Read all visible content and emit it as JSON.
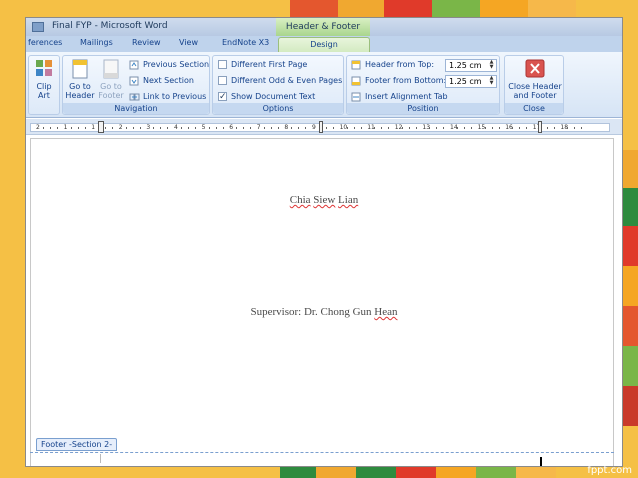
{
  "app": {
    "window_title": "Final FYP - Microsoft Word",
    "contextual_tools": "Header & Footer Tools"
  },
  "tabs": [
    {
      "label": "ferences"
    },
    {
      "label": "Mailings"
    },
    {
      "label": "Review"
    },
    {
      "label": "View"
    },
    {
      "label": "EndNote X3"
    },
    {
      "label": "Design"
    }
  ],
  "ribbon": {
    "insert": {
      "clip_art": "Clip Art"
    },
    "navigation": {
      "label": "Navigation",
      "go_to_header": "Go to Header",
      "go_to_footer": "Go to Footer",
      "previous_section": "Previous Section",
      "next_section": "Next Section",
      "link_to_previous": "Link to Previous"
    },
    "options": {
      "label": "Options",
      "different_first_page": "Different First Page",
      "different_odd_even": "Different Odd & Even Pages",
      "show_document_text": "Show Document Text",
      "different_first_page_checked": false,
      "different_odd_even_checked": false,
      "show_document_text_checked": true
    },
    "position": {
      "label": "Position",
      "header_from_top": "Header from Top:",
      "header_from_top_value": "1.25 cm",
      "footer_from_bottom": "Footer from Bottom:",
      "footer_from_bottom_value": "1.25 cm",
      "insert_alignment_tab": "Insert Alignment Tab"
    },
    "close": {
      "label": "Close",
      "close_header_footer": "Close Header and Footer"
    }
  },
  "ruler": {
    "numbers": [
      "2",
      "1",
      "1",
      "2",
      "3",
      "4",
      "5",
      "6",
      "7",
      "8",
      "9",
      "10",
      "11",
      "12",
      "13",
      "14",
      "15",
      "16",
      "17",
      "18"
    ]
  },
  "document": {
    "author_name": "Chia Siew Lian",
    "author_parts": [
      "Chia",
      "Siew",
      "Lian"
    ],
    "supervisor_prefix": "Supervisor: Dr. Chong Gun ",
    "supervisor_last": "Hean",
    "footer_tag": "Footer -Section 2-"
  },
  "watermark": "fppt.com"
}
